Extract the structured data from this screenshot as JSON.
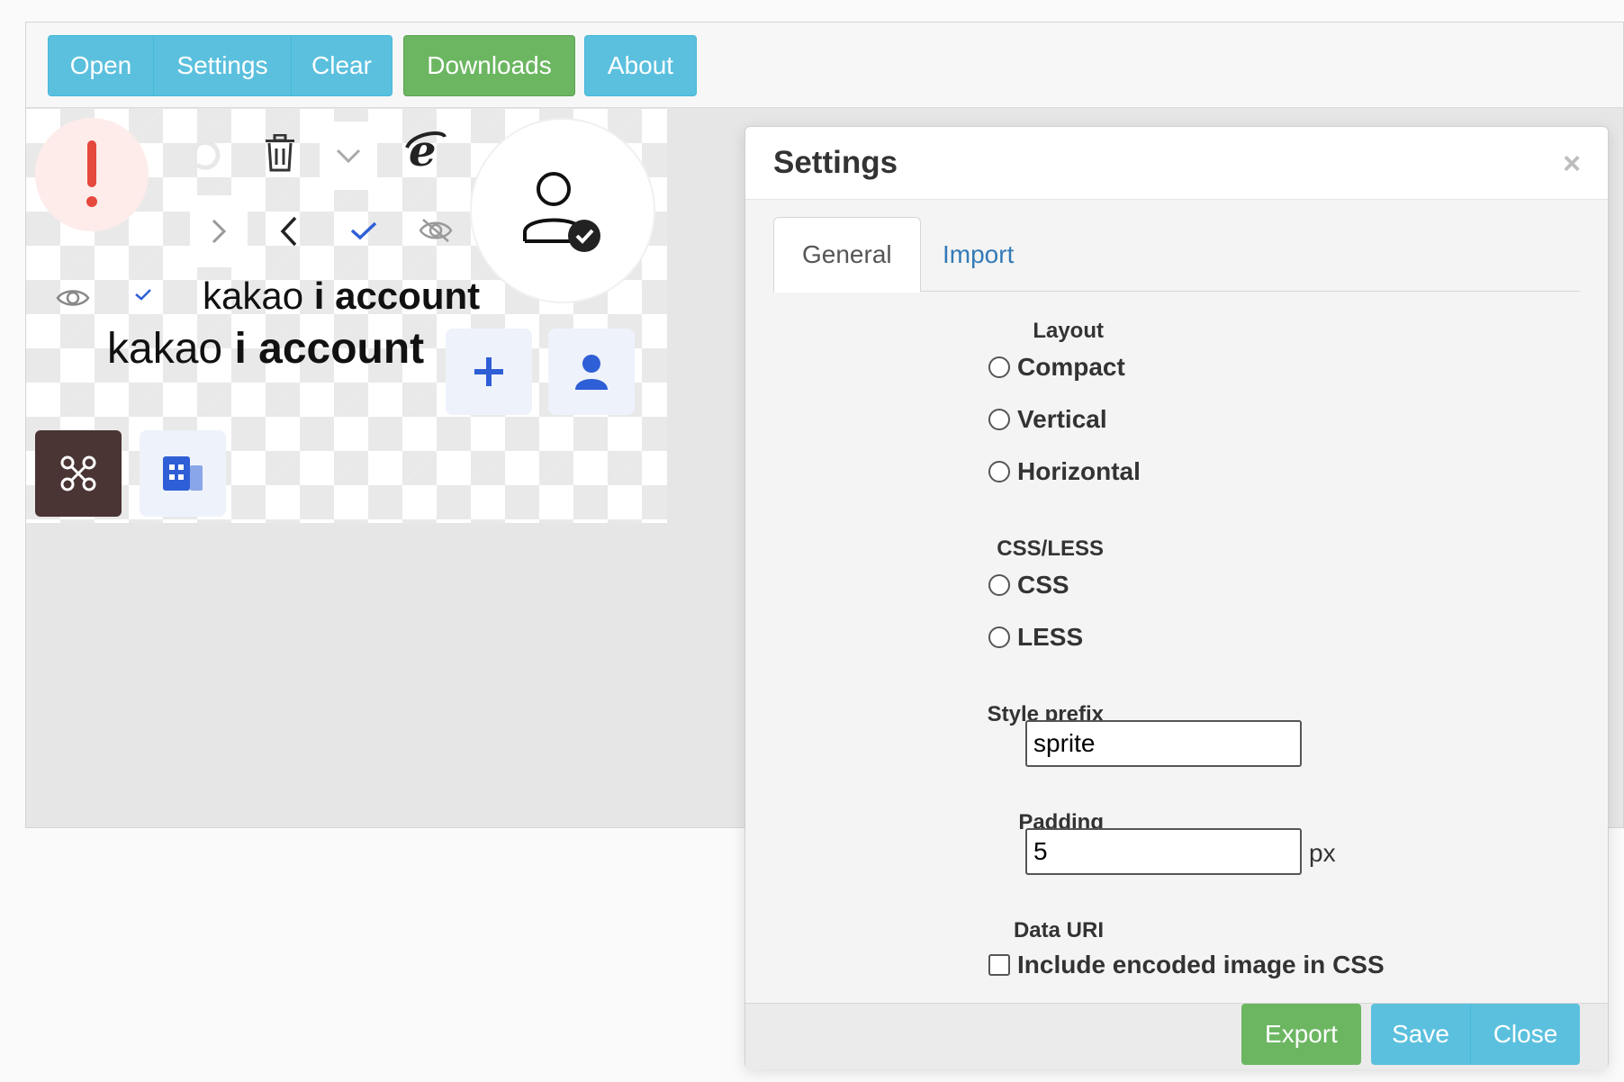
{
  "toolbar": {
    "open_label": "Open",
    "settings_label": "Settings",
    "clear_label": "Clear",
    "downloads_label": "Downloads",
    "about_label": "About"
  },
  "canvas": {
    "sprites": [
      "alert-icon",
      "undo-icon",
      "trash-icon",
      "chevron-down-icon",
      "internet-explorer-icon",
      "user-check-icon",
      "chevron-right-icon",
      "chevron-left-icon",
      "check-icon",
      "eye-off-icon",
      "eye-icon",
      "check-small-icon",
      "kakao-i-account-logo-small",
      "kakao-i-account-logo-large",
      "plus-icon",
      "person-icon",
      "command-icon",
      "building-icon"
    ],
    "logo_text_kakao": "kakao",
    "logo_text_i": "i",
    "logo_text_account": "account"
  },
  "modal": {
    "title": "Settings",
    "close_symbol": "×",
    "tabs": [
      {
        "label": "General",
        "active": true
      },
      {
        "label": "Import",
        "active": false
      }
    ],
    "layout": {
      "label": "Layout",
      "options": [
        "Compact",
        "Vertical",
        "Horizontal"
      ]
    },
    "css_less": {
      "label": "CSS/LESS",
      "options": [
        "CSS",
        "LESS"
      ]
    },
    "style_prefix": {
      "label": "Style prefix",
      "value": "sprite"
    },
    "padding": {
      "label": "Padding",
      "value": "5",
      "unit": "px"
    },
    "data_uri": {
      "label": "Data URI",
      "checkbox_label": "Include encoded image in CSS",
      "checked": false
    },
    "footer": {
      "export_label": "Export",
      "save_label": "Save",
      "close_label": "Close"
    }
  },
  "colors": {
    "info": "#5bc0de",
    "success": "#6cb662",
    "link": "#337ab7",
    "alert_red": "#e5483d",
    "accent_blue": "#2f5fd6"
  }
}
